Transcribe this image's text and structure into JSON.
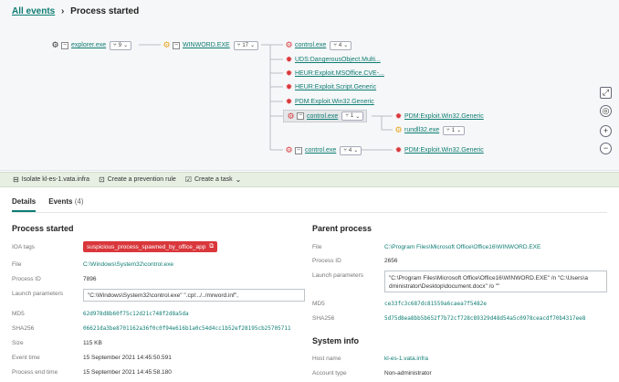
{
  "breadcrumb": {
    "root": "All events",
    "current": "Process started"
  },
  "tree": {
    "explorer": {
      "name": "explorer.exe",
      "count": "9"
    },
    "winword": {
      "name": "WINWORD.EXE",
      "count": "17"
    },
    "control1": {
      "name": "control.exe",
      "count": "4"
    },
    "uds": {
      "name": "UDS:DangerousObject.Multi..."
    },
    "heur1": {
      "name": "HEUR:Exploit.MSOffice.CVE-..."
    },
    "heur2": {
      "name": "HEUR:Exploit.Script.Generic"
    },
    "pdm1": {
      "name": "PDM:Exploit.Win32.Generic"
    },
    "control2": {
      "name": "control.exe",
      "count": "1"
    },
    "pdm2": {
      "name": "PDM:Exploit.Win32.Generic"
    },
    "rundll": {
      "name": "rundll32.exe",
      "count": "1"
    },
    "control3": {
      "name": "control.exe",
      "count": "4"
    },
    "pdm3": {
      "name": "PDM:Exploit.Win32.Generic"
    }
  },
  "actions": {
    "isolate": "Isolate kl-es-1.vata.infra",
    "prevention": "Create a prevention rule",
    "task": "Create a task"
  },
  "tabs": {
    "details": "Details",
    "events": "Events",
    "events_count": "(4)"
  },
  "process": {
    "title": "Process started",
    "ioa_label": "IOA tags",
    "ioa_tag": "suspicious_process_spawned_by_office_app",
    "file_label": "File",
    "file": "C:\\Windows\\System32\\control.exe",
    "pid_label": "Process ID",
    "pid": "7896",
    "params_label": "Launch parameters",
    "params": "\"C:\\Windows\\System32\\control.exe\" \".cpl:../../mrword.inf\",",
    "md5_label": "MD5",
    "md5": "62d978d8b60f75c12d21c748f2d8a5da",
    "sha_label": "SHA256",
    "sha": "06621da3be8701162a36f0c0f94e616b1a0c54d4cc1b52ef28195cb25705711",
    "size_label": "Size",
    "size": "115 KB",
    "etime_label": "Event time",
    "etime": "15 September 2021 14:45:50.591",
    "petime_label": "Process end time",
    "petime": "15 September 2021 14:45:58.180"
  },
  "parent": {
    "title": "Parent process",
    "file_label": "File",
    "file": "C:\\Program Files\\Microsoft Office\\Office16\\WINWORD.EXE",
    "pid_label": "Process ID",
    "pid": "2656",
    "params_label": "Launch parameters",
    "params_1": "\"C:\\Program Files\\Microsoft Office\\Office16\\WINWORD.EXE\" /n \"C:\\Users\\a",
    "params_2": "dministrator\\Desktop\\document.docx\" /o \"\"",
    "md5_label": "MD5",
    "md5": "ce33fc3c687dc81559a6caea7f5482e",
    "sha_label": "SHA256",
    "sha": "5d75d8ea8bb5b652f7b72cf728c89329d48d54a5c0978ceacdf70b4317ee8"
  },
  "sysinfo": {
    "title": "System info",
    "host_label": "Host name",
    "host": "kl-es-1.vata.infra",
    "acct_label": "Account type",
    "acct": "Non-administrator"
  },
  "colors": {
    "accent": "#0e7d73",
    "alert": "#d9373b",
    "warning": "#e8a317"
  }
}
